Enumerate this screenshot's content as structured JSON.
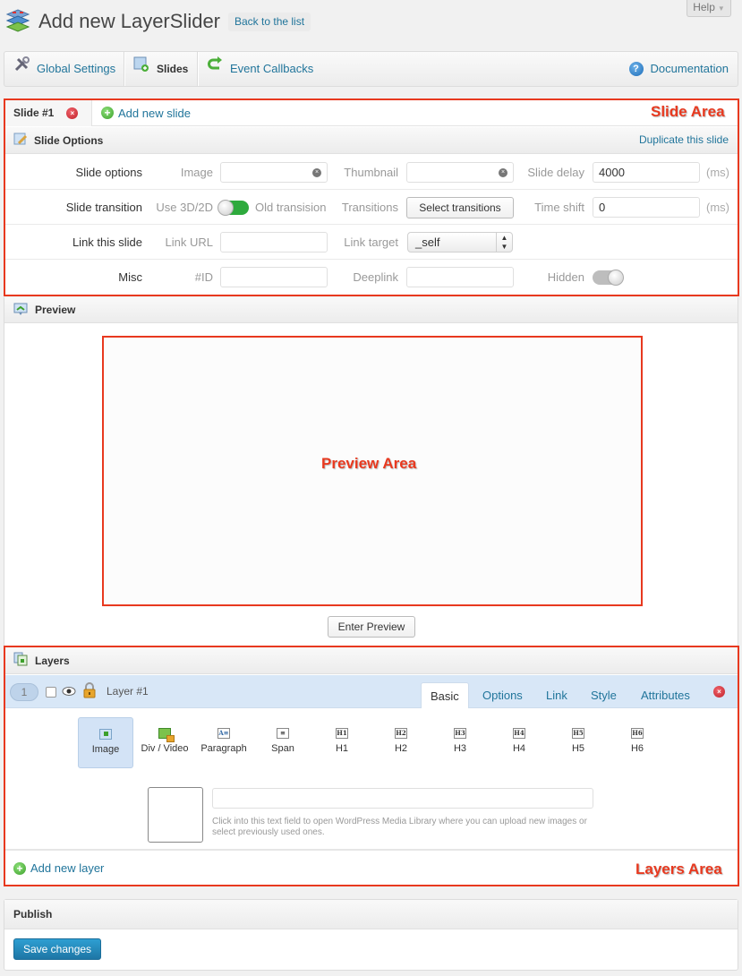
{
  "header": {
    "title": "Add new LayerSlider",
    "back_label": "Back to the list",
    "help_label": "Help"
  },
  "toolbar": {
    "items": [
      {
        "label": "Global Settings",
        "icon": "tools-icon"
      },
      {
        "label": "Slides",
        "icon": "slides-icon",
        "active": true
      },
      {
        "label": "Event Callbacks",
        "icon": "callback-arrow-icon"
      }
    ],
    "documentation_label": "Documentation"
  },
  "slide_area": {
    "tabs": [
      {
        "label": "Slide #1"
      }
    ],
    "add_slide_label": "Add new slide",
    "options_title": "Slide Options",
    "duplicate_label": "Duplicate this slide",
    "rows": {
      "slide_options": {
        "label": "Slide options",
        "image_label": "Image",
        "image_value": "",
        "thumbnail_label": "Thumbnail",
        "thumbnail_value": "",
        "delay_label": "Slide delay",
        "delay_value": "4000",
        "delay_unit": "(ms)"
      },
      "slide_transition": {
        "label": "Slide transition",
        "use_label": "Use 3D/2D",
        "toggle_on": true,
        "old_label": "Old transision",
        "transitions_label": "Transitions",
        "select_btn": "Select transitions",
        "timeshift_label": "Time shift",
        "timeshift_value": "0",
        "timeshift_unit": "(ms)"
      },
      "link": {
        "label": "Link this slide",
        "url_label": "Link URL",
        "url_value": "",
        "target_label": "Link target",
        "target_value": "_self"
      },
      "misc": {
        "label": "Misc",
        "id_label": "#ID",
        "id_value": "",
        "deeplink_label": "Deeplink",
        "deeplink_value": "",
        "hidden_label": "Hidden",
        "hidden_on": false
      }
    },
    "annotation": "Slide Area"
  },
  "preview": {
    "title": "Preview",
    "annotation": "Preview Area",
    "enter_label": "Enter Preview"
  },
  "layers": {
    "title": "Layers",
    "layer": {
      "number": "1",
      "name": "Layer #1",
      "tabs": [
        "Basic",
        "Options",
        "Link",
        "Style",
        "Attributes"
      ],
      "active_tab": "Basic"
    },
    "types": [
      {
        "label": "Image",
        "glyph": "",
        "active": true
      },
      {
        "label": "Div / Video",
        "glyph": ""
      },
      {
        "label": "Paragraph",
        "glyph": "A≡"
      },
      {
        "label": "Span",
        "glyph": "≡"
      },
      {
        "label": "H1",
        "glyph": "H1"
      },
      {
        "label": "H2",
        "glyph": "H2"
      },
      {
        "label": "H3",
        "glyph": "H3"
      },
      {
        "label": "H4",
        "glyph": "H4"
      },
      {
        "label": "H5",
        "glyph": "H5"
      },
      {
        "label": "H6",
        "glyph": "H6"
      }
    ],
    "image_url_value": "",
    "hint": "Click into this text field to open WordPress Media Library where you can upload new images or select previously used ones.",
    "add_layer_label": "Add new layer",
    "annotation": "Layers Area"
  },
  "publish": {
    "title": "Publish",
    "save_label": "Save changes"
  },
  "colors": {
    "link": "#21759b",
    "annotation_red": "#e8391f",
    "toggle_green": "#2eaa3d",
    "save_blue": "#2582b6"
  }
}
